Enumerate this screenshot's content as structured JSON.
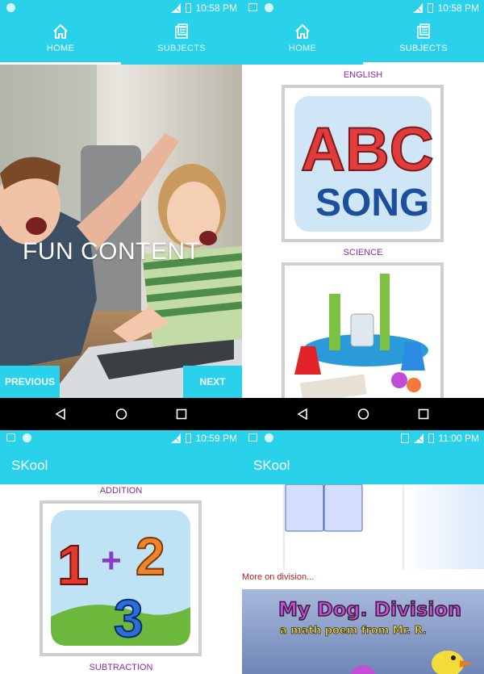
{
  "status_bars": [
    {
      "time": "10:58 PM"
    },
    {
      "time": "10:58 PM"
    },
    {
      "time": "10:59 PM"
    },
    {
      "time": "11:00 PM"
    }
  ],
  "tabs": [
    {
      "label": "HOME",
      "icon": "home-icon"
    },
    {
      "label": "SUBJECTS",
      "icon": "books-icon"
    }
  ],
  "home": {
    "slide_text": "FUN CONTENT",
    "previous_label": "PREVIOUS",
    "next_label": "NEXT"
  },
  "subjects": {
    "english_label": "ENGLISH",
    "science_label": "SCIENCE",
    "abc_top": "ABC",
    "abc_bottom": "SONG"
  },
  "app_title": "SKool",
  "math": {
    "addition_label": "ADDITION",
    "subtraction_label": "SUBTRACTION",
    "n1": "1",
    "plus": "+",
    "n2": "2",
    "n3": "3"
  },
  "division": {
    "more_link": "More on division...",
    "video_title": "My Dog. Division",
    "video_subtitle": "a math poem from Mr. R."
  },
  "colors": {
    "accent": "#29d2ea",
    "label_purple": "#8a2a9b",
    "link_red": "#b02323"
  }
}
